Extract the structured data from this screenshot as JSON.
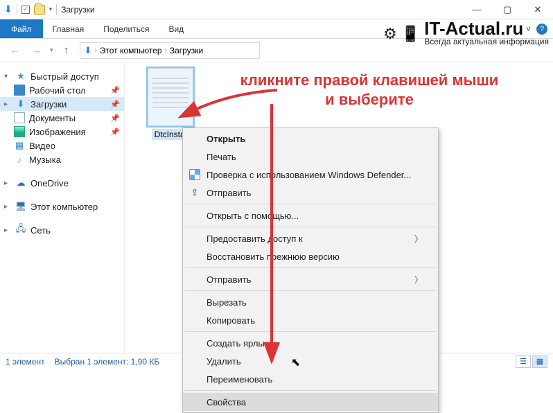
{
  "title": "Загрузки",
  "ribbon": {
    "file": "Файл",
    "tabs": [
      "Главная",
      "Поделиться",
      "Вид"
    ]
  },
  "breadcrumb": {
    "root": "Этот компьютер",
    "current": "Загрузки"
  },
  "nav": {
    "quick": "Быстрый доступ",
    "items": [
      {
        "label": "Рабочий стол",
        "icon": "desktop"
      },
      {
        "label": "Загрузки",
        "icon": "download",
        "selected": true
      },
      {
        "label": "Документы",
        "icon": "document"
      },
      {
        "label": "Изображения",
        "icon": "image"
      },
      {
        "label": "Видео",
        "icon": "video"
      },
      {
        "label": "Музыка",
        "icon": "music"
      }
    ],
    "onedrive": "OneDrive",
    "thispc": "Этот компьютер",
    "network": "Сеть"
  },
  "file": {
    "name": "DtcInstal"
  },
  "status": {
    "count": "1 элемент",
    "selection": "Выбран 1 элемент: 1,90 КБ"
  },
  "context": {
    "open": "Открыть",
    "print": "Печать",
    "defender": "Проверка с использованием Windows Defender...",
    "share": "Отправить",
    "open_with": "Открыть с помощью...",
    "grant_access": "Предоставить доступ к",
    "restore": "Восстановить прежнюю версию",
    "send_to": "Отправить",
    "cut": "Вырезать",
    "copy": "Копировать",
    "shortcut": "Создать ярлык",
    "delete": "Удалить",
    "rename": "Переименовать",
    "properties": "Свойства"
  },
  "annotation": {
    "line1": "кликните правой клавишей мыши",
    "line2": "и выберите"
  },
  "watermark": {
    "title": "IT-Actual.ru",
    "subtitle": "Всегда актуальная информация"
  }
}
